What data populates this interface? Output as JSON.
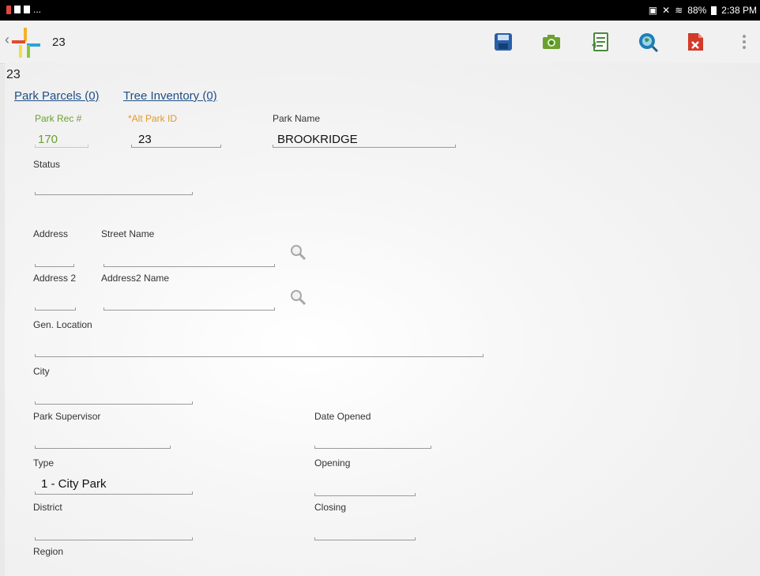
{
  "status_bar": {
    "left_text": "...",
    "battery": "88%",
    "time": "2:38 PM"
  },
  "action_bar": {
    "title": "23",
    "actions": [
      {
        "name": "save-icon",
        "color": "#2a5fa8"
      },
      {
        "name": "camera-icon",
        "color": "#6aa12e"
      },
      {
        "name": "report-icon",
        "color": "#4a8a3a"
      },
      {
        "name": "map-search-icon",
        "color": "#1e7fb8"
      },
      {
        "name": "delete-file-icon",
        "color": "#d23a2a"
      }
    ]
  },
  "record": {
    "title": "23",
    "links": {
      "park_parcels": "Park Parcels (0)",
      "tree_inventory": "Tree Inventory (0)"
    },
    "fields": {
      "park_rec_label": "Park Rec #",
      "park_rec_value": "170",
      "alt_park_id_label": "*Alt Park ID",
      "alt_park_id_value": "23",
      "park_name_label": "Park Name",
      "park_name_value": "BROOKRIDGE",
      "status_label": "Status",
      "status_value": "",
      "address_label": "Address",
      "address_value": "",
      "street_name_label": "Street Name",
      "street_name_value": "",
      "address2_label": "Address 2",
      "address2_value": "",
      "address2_name_label": "Address2 Name",
      "address2_name_value": "",
      "gen_location_label": "Gen. Location",
      "gen_location_value": "",
      "city_label": "City",
      "city_value": "",
      "park_supervisor_label": "Park Supervisor",
      "park_supervisor_value": "",
      "date_opened_label": "Date Opened",
      "date_opened_value": "",
      "type_label": "Type",
      "type_value": "1 - City Park",
      "opening_label": "Opening",
      "opening_value": "",
      "district_label": "District",
      "district_value": "",
      "closing_label": "Closing",
      "closing_value": "",
      "region_label": "Region"
    }
  }
}
